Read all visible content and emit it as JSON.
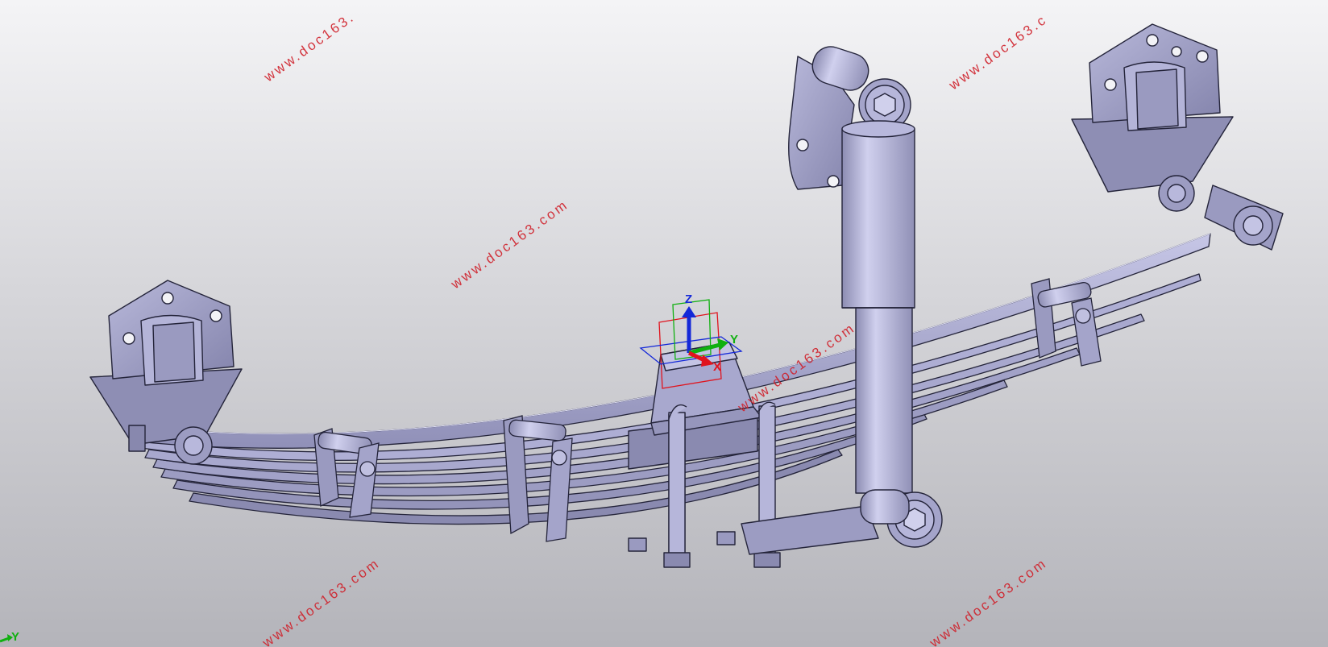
{
  "watermark": {
    "text": "www.doc163.com",
    "text_top_left": "www.doc163.",
    "text_top_right": "www.doc163.c"
  },
  "compass": {
    "x_label": "X",
    "y_label": "Y",
    "z_label": "Z"
  },
  "corner_axis": {
    "y_label": "Y"
  },
  "colors": {
    "part_fill": "#a6a6c9",
    "part_light": "#c4c4e4",
    "part_dark": "#7c7ca2",
    "outline": "#24243a",
    "axis_x": "#e0141e",
    "axis_y": "#10b010",
    "axis_z": "#1428d8",
    "watermark": "#d0202a"
  }
}
